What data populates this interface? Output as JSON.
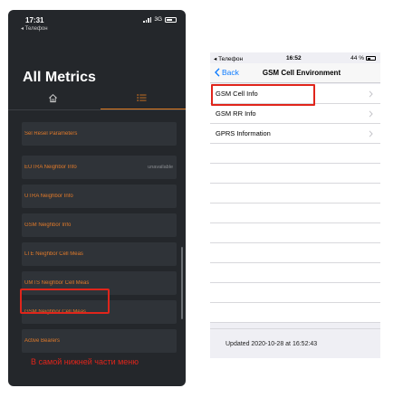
{
  "left_phone": {
    "status_time": "17:31",
    "status_sub": "◂ Телефон",
    "network": "3G",
    "title": "All Metrics",
    "items": [
      {
        "label": "Sel Resel Parameters",
        "value": ""
      },
      {
        "label": "EUTRA Neighbor Info",
        "value": "unavailable"
      },
      {
        "label": "UTRA Neighbor Info",
        "value": ""
      },
      {
        "label": "GSM Neighbor Info",
        "value": ""
      },
      {
        "label": "LTE Neighbor Cell Meas",
        "value": ""
      },
      {
        "label": "UMTS Neighbor Cell Meas",
        "value": ""
      },
      {
        "label": "GSM Neighbor Cell Meas",
        "value": ""
      },
      {
        "label": "Active Bearers",
        "value": ""
      }
    ],
    "note": "В самой нижней части меню",
    "accent": "#e07a1f",
    "highlight": "#e0251b"
  },
  "right_phone": {
    "status_left": "◂ Телефон",
    "status_time": "16:52",
    "battery": "44 %",
    "back_label": "Back",
    "title": "GSM Cell Environment",
    "rows": [
      {
        "label": "GSM Cell Info"
      },
      {
        "label": "GSM RR Info"
      },
      {
        "label": "GPRS Information"
      }
    ],
    "footer": "Updated 2020-10-28 at 16:52:43",
    "link_color": "#0a7aff"
  }
}
